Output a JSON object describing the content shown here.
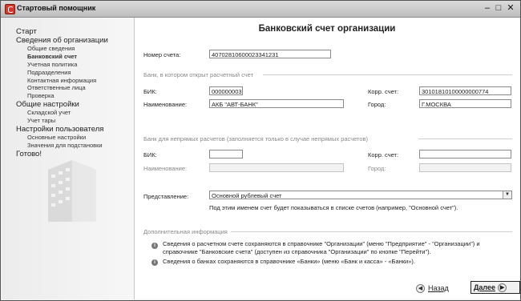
{
  "window": {
    "title": "Стартовый помощник"
  },
  "sidebar": {
    "items": [
      {
        "label": "Старт",
        "level": 1
      },
      {
        "label": "Сведения об организации",
        "level": 1
      },
      {
        "label": "Общие сведения",
        "level": 2
      },
      {
        "label": "Банковский счет",
        "level": 2,
        "active": true
      },
      {
        "label": "Учетная политика",
        "level": 2
      },
      {
        "label": "Подразделения",
        "level": 2
      },
      {
        "label": "Контактная информация",
        "level": 2
      },
      {
        "label": "Ответственные лица",
        "level": 2
      },
      {
        "label": "Проверка",
        "level": 2
      },
      {
        "label": "Общие настройки",
        "level": 1
      },
      {
        "label": "Складской учет",
        "level": 2
      },
      {
        "label": "Учет тары",
        "level": 2
      },
      {
        "label": "Настройки пользователя",
        "level": 1
      },
      {
        "label": "Основные настройки",
        "level": 2
      },
      {
        "label": "Значения для подстановки",
        "level": 2
      },
      {
        "label": "Готово!",
        "level": 1
      }
    ]
  },
  "main": {
    "heading": "Банковский счет организации",
    "account": {
      "label": "Номер счета:",
      "value": "40702810600023341231"
    },
    "bank_section": {
      "title": "Банк, в котором открыт расчетный счет",
      "bik_label": "БИК:",
      "bik_value": "000000003",
      "corr_label": "Корр. счет:",
      "corr_value": "30101810100000000774",
      "name_label": "Наименование:",
      "name_value": "АКБ \"АВТ-БАНК\"",
      "city_label": "Город:",
      "city_value": "Г.МОСКВА"
    },
    "indirect_section": {
      "title": "Банк для непрямых расчетов (заполняется только в случае непрямых расчетов)",
      "bik_label": "БИК:",
      "bik_value": "",
      "corr_label": "Корр. счет:",
      "corr_value": "",
      "name_label": "Наименование:",
      "name_value": "",
      "city_label": "Город:",
      "city_value": ""
    },
    "presentation": {
      "label": "Представление:",
      "value": "Основной рублевый счет",
      "hint": "Под этим именем счет будет показываться в списке счетов (например, \"Основной счет\")."
    },
    "additional": {
      "title": "Дополнительная информация",
      "info1_line1": "Сведения о расчетном счете сохраняются в справочнике \"Организации\" (меню \"Предприятие\" - \"Организации\") и",
      "info1_line2": "справочнике \"Банковские счета\" (доступен из справочника \"Организации\" по кнопке \"Перейти\").",
      "info2": "Сведения о банках сохраняются в справочнике «Банки» (меню «Банк и касса» - «Банки»)."
    },
    "nav": {
      "back_label": "Назад",
      "next_label": "Далее"
    }
  }
}
